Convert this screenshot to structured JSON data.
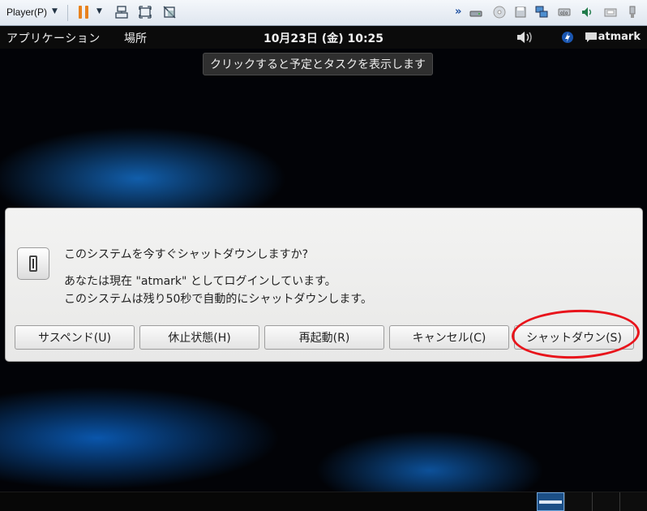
{
  "vm_toolbar": {
    "player_menu_label": "Player(P)"
  },
  "gnome_panel": {
    "applications_label": "アプリケーション",
    "places_label": "場所",
    "clock": "10月23日 (金) 10:25",
    "username": "atmark"
  },
  "tooltip": {
    "text": "クリックすると予定とタスクを表示します"
  },
  "dialog": {
    "heading": "このシステムを今すぐシャットダウンしますか?",
    "line1": "あなたは現在 \"atmark\" としてログインしています。",
    "line2": "このシステムは残り50秒で自動的にシャットダウンします。",
    "buttons": {
      "suspend": "サスペンド(U)",
      "hibernate": "休止状態(H)",
      "restart": "再起動(R)",
      "cancel": "キャンセル(C)",
      "shutdown": "シャットダウン(S)"
    }
  },
  "colors": {
    "annotation_circle": "#e8141b",
    "pause_icon": "#e8821e",
    "active_workspace": "#1c4f86"
  }
}
